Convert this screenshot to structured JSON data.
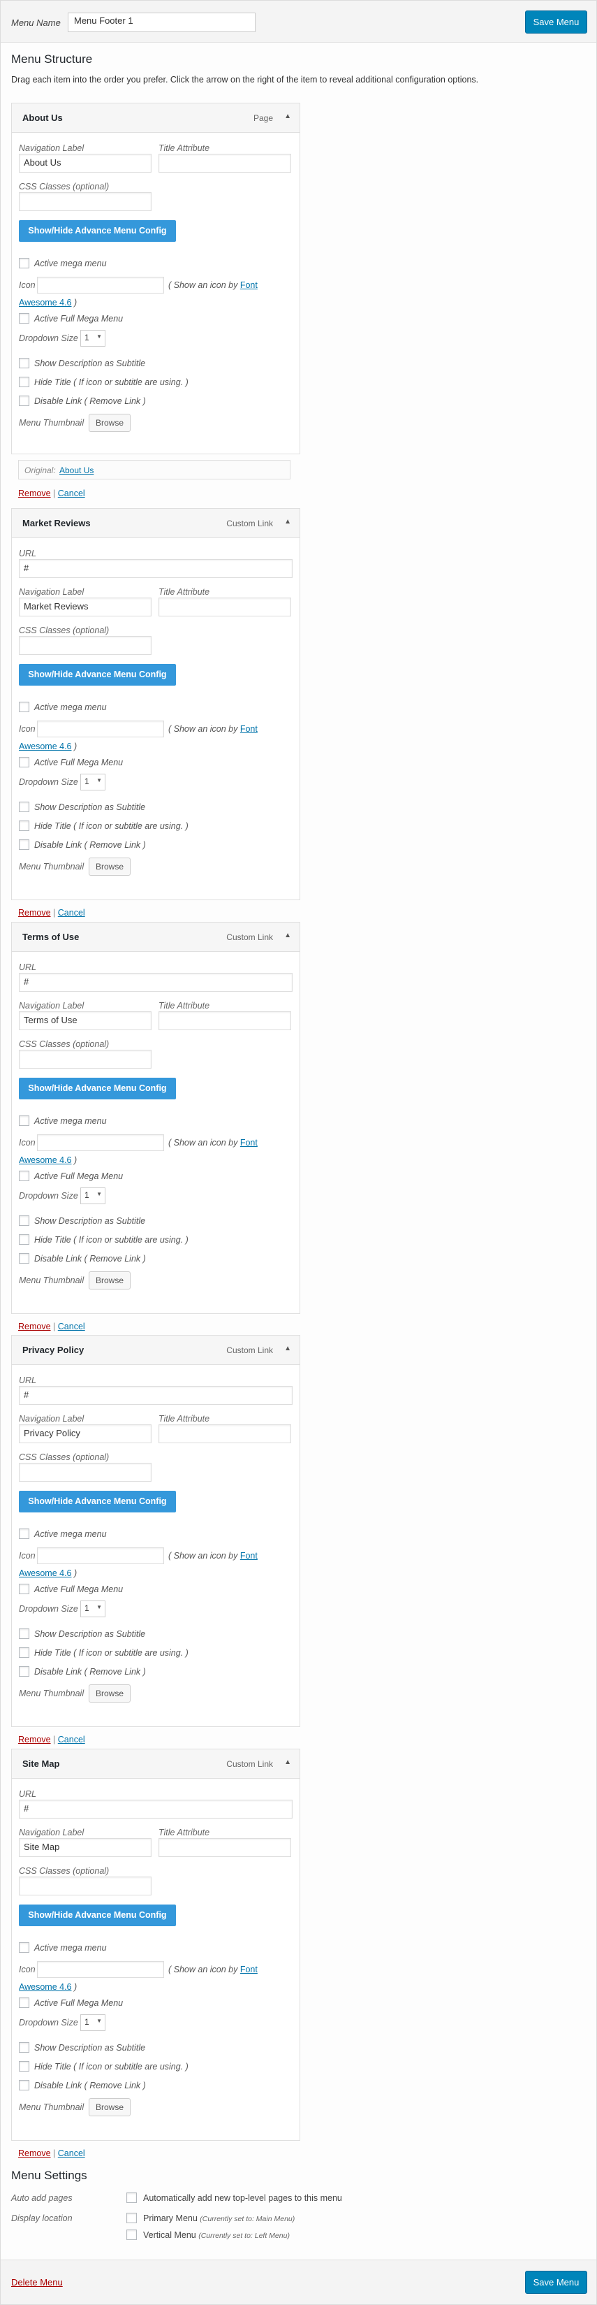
{
  "header": {
    "menu_name_label": "Menu Name",
    "menu_name_value": "Menu Footer 1",
    "save_label": "Save Menu"
  },
  "structure": {
    "title": "Menu Structure",
    "instructions": "Drag each item into the order you prefer. Click the arrow on the right of the item to reveal additional configuration options."
  },
  "item_fields": {
    "url_label": "URL",
    "nav_label": "Navigation Label",
    "title_attr_label": "Title Attribute",
    "css_label": "CSS Classes (optional)",
    "advance_button": "Show/Hide Advance Menu Config",
    "active_mega": "Active mega menu",
    "icon_label": "Icon",
    "icon_hint_prefix": "( Show an icon by",
    "icon_hint_link1": "Font",
    "icon_hint_link2": "Awesome 4.6",
    "icon_hint_suffix": ")",
    "active_full_mega": "Active Full Mega Menu",
    "dropdown_size_label": "Dropdown Size",
    "dropdown_size_value": "1",
    "show_desc": "Show Description as Subtitle",
    "hide_title": "Hide Title ( If icon or subtitle are using. )",
    "disable_link": "Disable Link ( Remove Link )",
    "thumbnail_label": "Menu Thumbnail",
    "browse": "Browse",
    "original_label": "Original:",
    "remove": "Remove",
    "separator": "|",
    "cancel": "Cancel"
  },
  "items": [
    {
      "title": "About Us",
      "type": "Page",
      "nav_label": "About Us",
      "original": "About Us"
    },
    {
      "title": "Market Reviews",
      "type": "Custom Link",
      "url": "#",
      "nav_label": "Market Reviews"
    },
    {
      "title": "Terms of Use",
      "type": "Custom Link",
      "url": "#",
      "nav_label": "Terms of Use"
    },
    {
      "title": "Privacy Policy",
      "type": "Custom Link",
      "url": "#",
      "nav_label": "Privacy Policy"
    },
    {
      "title": "Site Map",
      "type": "Custom Link",
      "url": "#",
      "nav_label": "Site Map"
    }
  ],
  "settings": {
    "title": "Menu Settings",
    "auto_add_label": "Auto add pages",
    "auto_add_option": "Automatically add new top-level pages to this menu",
    "display_location_label": "Display location",
    "locations": [
      {
        "name": "Primary Menu",
        "note": "(Currently set to: Main Menu)"
      },
      {
        "name": "Vertical Menu",
        "note": "(Currently set to: Left Menu)"
      }
    ]
  },
  "footer": {
    "delete_label": "Delete Menu",
    "save_label": "Save Menu"
  },
  "icons": {
    "collapse_arrow": "arrow-up-icon",
    "select_arrow": "chevron-down-icon"
  },
  "colors": {
    "primary_button": "#0085ba",
    "advance_button": "#3498db",
    "link": "#0073aa",
    "delete": "#aa0000"
  }
}
